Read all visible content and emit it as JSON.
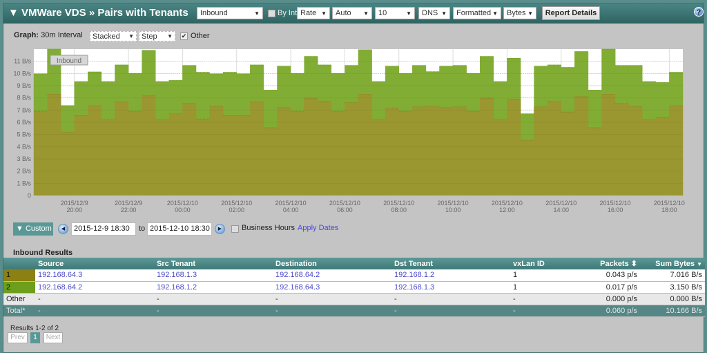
{
  "header": {
    "title": "▼ VMWare VDS » Pairs with Tenants",
    "direction_select": "Inbound",
    "by_int_label": "By Int",
    "by_int_checked": false,
    "metric_select": "Rate",
    "scale_select": "Auto",
    "count_select": "10",
    "resolve_select": "DNS",
    "format_select": "Formatted",
    "unit_select": "Bytes",
    "report_details_label": "Report Details",
    "help_icon": "?"
  },
  "graph_controls": {
    "graph_label": "Graph:",
    "interval_text": "30m Interval",
    "style_select": "Stacked",
    "line_select": "Step",
    "other_label": "Other",
    "other_checked": true
  },
  "chart_data": {
    "type": "area",
    "title": "",
    "subtitle": "Inbound",
    "xlabel": "",
    "ylabel": "",
    "stacked": true,
    "step": true,
    "interval_minutes": 30,
    "x_start": "2015-12-9 18:30",
    "x_end": "2015-12-10 18:30",
    "ylim": [
      0,
      12
    ],
    "yticks": [
      "0",
      "1 B/s",
      "2 B/s",
      "3 B/s",
      "4 B/s",
      "5 B/s",
      "6 B/s",
      "7 B/s",
      "8 B/s",
      "9 B/s",
      "10 B/s",
      "11 B/s"
    ],
    "xticks": [
      {
        "pos": 3,
        "label": [
          "2015/12/9",
          "20:00"
        ]
      },
      {
        "pos": 7,
        "label": [
          "2015/12/9",
          "22:00"
        ]
      },
      {
        "pos": 11,
        "label": [
          "2015/12/10",
          "00:00"
        ]
      },
      {
        "pos": 15,
        "label": [
          "2015/12/10",
          "02:00"
        ]
      },
      {
        "pos": 19,
        "label": [
          "2015/12/10",
          "04:00"
        ]
      },
      {
        "pos": 23,
        "label": [
          "2015/12/10",
          "06:00"
        ]
      },
      {
        "pos": 27,
        "label": [
          "2015/12/10",
          "08:00"
        ]
      },
      {
        "pos": 31,
        "label": [
          "2015/12/10",
          "10:00"
        ]
      },
      {
        "pos": 35,
        "label": [
          "2015/12/10",
          "12:00"
        ]
      },
      {
        "pos": 39,
        "label": [
          "2015/12/10",
          "14:00"
        ]
      },
      {
        "pos": 43,
        "label": [
          "2015/12/10",
          "16:00"
        ]
      },
      {
        "pos": 47,
        "label": [
          "2015/12/10",
          "18:00"
        ]
      }
    ],
    "grid": true,
    "legend": "none",
    "series": [
      {
        "name": "192.168.64.3 → 192.168.64.2",
        "color": "#9a9630",
        "values": [
          6.9,
          8.3,
          5.2,
          6.55,
          7.35,
          6.2,
          7.65,
          6.9,
          8.2,
          6.2,
          6.7,
          7.55,
          6.27,
          7.3,
          6.55,
          6.55,
          7.65,
          5.55,
          7.2,
          6.9,
          7.97,
          7.7,
          6.9,
          7.6,
          8.3,
          6.2,
          7.17,
          6.9,
          7.26,
          7.3,
          7.2,
          7.26,
          6.9,
          7.97,
          6.2,
          7.88,
          4.53,
          7.26,
          7.7,
          6.84,
          8.1,
          5.55,
          8.3,
          7.55,
          7.3,
          6.2,
          6.4,
          7.35
        ]
      },
      {
        "name": "192.168.64.2 → 192.168.64.3",
        "color": "#82ad34",
        "values": [
          3.07,
          3.7,
          2.17,
          2.79,
          2.78,
          3.14,
          3.05,
          3.1,
          3.7,
          3.14,
          2.73,
          3.11,
          3.83,
          2.67,
          3.55,
          3.42,
          3.05,
          3.09,
          3.4,
          3.1,
          3.43,
          3.0,
          3.1,
          3.06,
          3.65,
          3.14,
          3.43,
          3.1,
          3.4,
          2.85,
          3.4,
          3.4,
          3.1,
          3.43,
          3.14,
          3.37,
          2.17,
          3.34,
          3.0,
          3.66,
          3.7,
          3.09,
          3.7,
          3.11,
          3.36,
          3.14,
          2.86,
          2.75
        ]
      }
    ]
  },
  "date_controls": {
    "custom_label": "▼ Custom",
    "start_date": "2015-12-9 18:30",
    "to_label": "to",
    "end_date": "2015-12-10 18:30",
    "business_hours_label": "Business Hours",
    "business_hours_checked": false,
    "apply_label": "Apply Dates"
  },
  "results": {
    "title": "Inbound Results",
    "columns": [
      "",
      "Source",
      "Src Tenant",
      "Destination",
      "Dst Tenant",
      "vxLan ID",
      "Packets",
      "Sum Bytes"
    ],
    "rows": [
      {
        "rank": "1",
        "color": "#8b8012",
        "source": "192.168.64.3",
        "src_tenant": "192.168.1.3",
        "destination": "192.168.64.2",
        "dst_tenant": "192.168.1.2",
        "vxlan": "1",
        "packets": "0.043 p/s",
        "bytes": "7.016 B/s"
      },
      {
        "rank": "2",
        "color": "#6d9e1c",
        "source": "192.168.64.2",
        "src_tenant": "192.168.1.2",
        "destination": "192.168.64.3",
        "dst_tenant": "192.168.1.3",
        "vxlan": "1",
        "packets": "0.017 p/s",
        "bytes": "3.150 B/s"
      }
    ],
    "other": {
      "label": "Other",
      "source": "-",
      "src_tenant": "-",
      "destination": "-",
      "dst_tenant": "-",
      "vxlan": "-",
      "packets": "0.000 p/s",
      "bytes": "0.000 B/s"
    },
    "total": {
      "label": "Total*",
      "source": "-",
      "src_tenant": "-",
      "destination": "-",
      "dst_tenant": "-",
      "vxlan": "-",
      "packets": "0.060 p/s",
      "bytes": "10.166 B/s"
    }
  },
  "pager": {
    "summary": "Results 1-2 of 2",
    "prev_label": "Prev",
    "current_page": "1",
    "next_label": "Next"
  }
}
